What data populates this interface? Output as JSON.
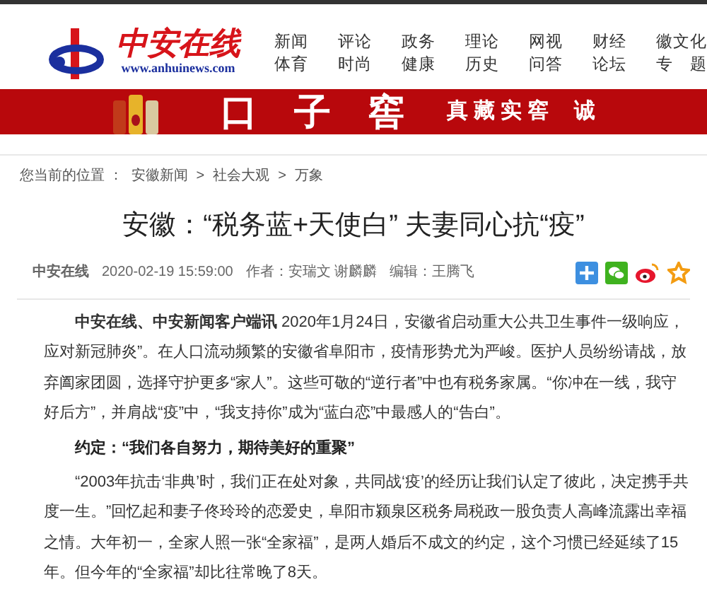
{
  "logo": {
    "name": "中安在线",
    "url": "www.anhuinews.com"
  },
  "nav": [
    [
      "新闻",
      "体育"
    ],
    [
      "评论",
      "时尚"
    ],
    [
      "政务",
      "健康"
    ],
    [
      "理论",
      "历史"
    ],
    [
      "网视",
      "问答"
    ],
    [
      "财经",
      "论坛"
    ],
    [
      "徽文化",
      "专　题"
    ]
  ],
  "banner": {
    "kind": "picture",
    "brand": "口　子　窖",
    "slogan": "真藏实窖",
    "cut": "诚"
  },
  "breadcrumb": {
    "label": "您当前的位置 ：",
    "items": [
      "安徽新闻",
      "社会大观",
      "万象"
    ],
    "separator": ">"
  },
  "article": {
    "title": "安徽：“税务蓝+天使白” 夫妻同心抗“疫”",
    "meta": {
      "source": "中安在线",
      "time": "2020-02-19 15:59:00",
      "author": "作者：安瑞文 谢麟麟",
      "editor": "编辑：王腾飞"
    },
    "blocks": [
      {
        "kind": "paragraph",
        "text": "**中安在线、中安新闻客户端讯** 2020年1月24日，安徽省启动重大公共卫生事件一级响应，应对新冠肺炎”。在人口流动频繁的安徽省阜阳市，疫情形势尤为严峻。医护人员纷纷请战，放弃阖家团圆，选择守护更多“家人”。这些可敬的“逆行者”中也有税务家属。“你冲在一线，我守好后方”，并肩战“疫”中，“我支持你”成为“蓝白恋”中最感人的“告白”。"
      },
      {
        "kind": "heading",
        "text": "约定：“我们各自努力，期待美好的重聚”"
      },
      {
        "kind": "paragraph",
        "text": "“2003年抗击‘非典’时，我们正在处对象，共同战‘疫’的经历让我们认定了彼此，决定携手共度一生。”回忆起和妻子佟玲玲的恋爱史，阜阳市颍泉区税务局税政一股负责人高峰流露出幸福之情。大年初一，全家人照一张“全家福”，是两人婚后不成文的约定，这个习惯已经延续了15年。但今年的“全家福”却比往常晚了8天。"
      }
    ]
  }
}
